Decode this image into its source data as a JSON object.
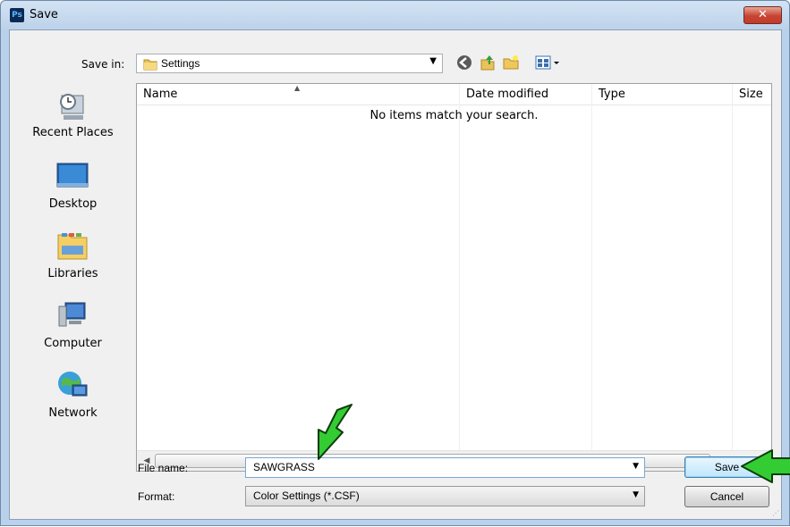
{
  "window": {
    "title": "Save",
    "app_icon_text": "Ps",
    "close_glyph": "✕"
  },
  "toolbar": {
    "save_in_label": "Save in:",
    "location": "Settings",
    "icons": [
      "back-icon",
      "up-folder-icon",
      "new-folder-icon",
      "view-menu-icon"
    ]
  },
  "places": [
    {
      "label": "Recent Places",
      "icon": "recent-places-icon"
    },
    {
      "label": "Desktop",
      "icon": "desktop-icon"
    },
    {
      "label": "Libraries",
      "icon": "libraries-icon"
    },
    {
      "label": "Computer",
      "icon": "computer-icon"
    },
    {
      "label": "Network",
      "icon": "network-icon"
    }
  ],
  "filelist": {
    "columns": [
      "Name",
      "Date modified",
      "Type",
      "Size"
    ],
    "empty_message": "No items match your search.",
    "scroll_grip": "III"
  },
  "form": {
    "filename_label": "File name:",
    "filename_value": "SAWGRASS",
    "format_label": "Format:",
    "format_value": "Color Settings (*.CSF)",
    "save_button": "Save",
    "cancel_button": "Cancel"
  },
  "annotation_colors": {
    "arrow_fill": "#33cc33",
    "arrow_stroke": "#0d3d0d"
  }
}
